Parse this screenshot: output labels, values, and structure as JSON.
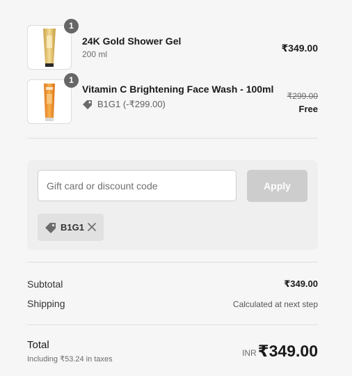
{
  "colors": {
    "background": "#f6f6f6",
    "quantity_badge": "#666666",
    "apply_button_disabled": "#cdcdcd",
    "discount_tag": "#e1e1e1"
  },
  "items": [
    {
      "quantity": "1",
      "name": "24K Gold Shower Gel",
      "variant": "200 ml",
      "price": "₹349.00",
      "image_icon": "gold-shower-gel-tube-image"
    },
    {
      "quantity": "1",
      "name": "Vitamin C Brightening Face Wash - 100ml",
      "discount_icon": "price-tag-icon",
      "discount": "B1G1 (-₹299.00)",
      "original_price": "₹299.00",
      "price": "Free",
      "image_icon": "vitamin-c-face-wash-tube-image"
    }
  ],
  "discount_form": {
    "placeholder": "Gift card or discount code",
    "value": "",
    "apply_label": "Apply",
    "applied_code": "B1G1",
    "applied_code_icon": "price-tag-icon",
    "remove_icon": "close-icon"
  },
  "summary": {
    "subtotal_label": "Subtotal",
    "subtotal_value": "₹349.00",
    "shipping_label": "Shipping",
    "shipping_value": "Calculated at next step",
    "total_label": "Total",
    "tax_note": "Including ₹53.24 in taxes",
    "currency": "INR",
    "total_value": "₹349.00"
  }
}
